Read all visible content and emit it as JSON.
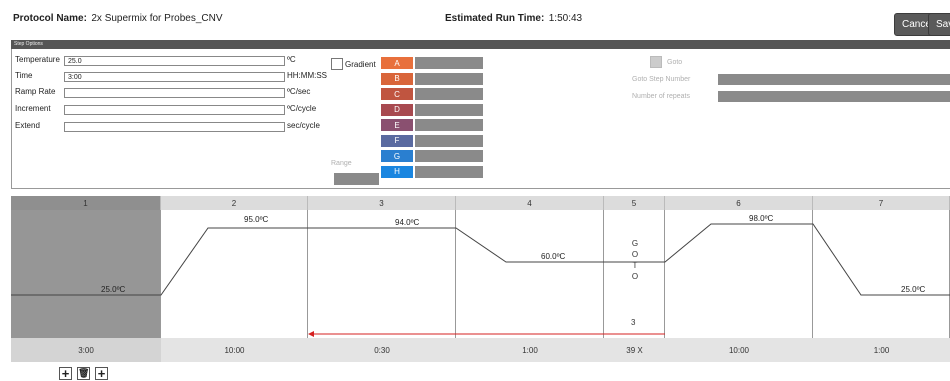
{
  "header": {
    "protocol_label": "Protocol Name:",
    "protocol_value": "2x Supermix for Probes_CNV",
    "runtime_label": "Estimated Run Time:",
    "runtime_value": "1:50:43",
    "cancel_label": "Cancel",
    "save_label": "Save"
  },
  "step_options": {
    "title": "Step Options",
    "fields": [
      {
        "label": "Temperature",
        "value": "25.0",
        "unit": "ºC"
      },
      {
        "label": "Time",
        "value": "3:00",
        "unit": "HH:MM:SS"
      },
      {
        "label": "Ramp Rate",
        "value": "",
        "unit": "ºC/sec"
      },
      {
        "label": "Increment",
        "value": "",
        "unit": "ºC/cycle"
      },
      {
        "label": "Extend",
        "value": "",
        "unit": "sec/cycle"
      }
    ],
    "gradient_label": "Gradient",
    "range_label": "Range",
    "gradient_rows": [
      {
        "label": "A",
        "color": "#e8703c"
      },
      {
        "label": "B",
        "color": "#d9653a"
      },
      {
        "label": "C",
        "color": "#c05540"
      },
      {
        "label": "D",
        "color": "#a84a50"
      },
      {
        "label": "E",
        "color": "#8a5070"
      },
      {
        "label": "F",
        "color": "#5a6aa0"
      },
      {
        "label": "G",
        "color": "#2a7fd0"
      },
      {
        "label": "H",
        "color": "#1a86e0"
      }
    ],
    "goto_label": "Goto",
    "goto_step_label": "Goto Step Number",
    "repeats_label": "Number of repeats"
  },
  "protocol_steps": [
    {
      "num": "1",
      "temp": "25.0ºC",
      "time": "3:00"
    },
    {
      "num": "2",
      "temp": "95.0ºC",
      "time": "10:00"
    },
    {
      "num": "3",
      "temp": "94.0ºC",
      "time": "0:30"
    },
    {
      "num": "4",
      "temp": "60.0ºC",
      "time": "1:00"
    },
    {
      "num": "5",
      "goto_letters": "G\nO\nT\nO",
      "goto_step": "3",
      "time": "39 X"
    },
    {
      "num": "6",
      "temp": "98.0ºC",
      "time": "10:00"
    },
    {
      "num": "7",
      "temp": "25.0ºC",
      "time": "1:00"
    }
  ],
  "accent": {
    "selected_col": "#969696",
    "goto_arrow": "#d62020",
    "header_bar": "#555555"
  }
}
